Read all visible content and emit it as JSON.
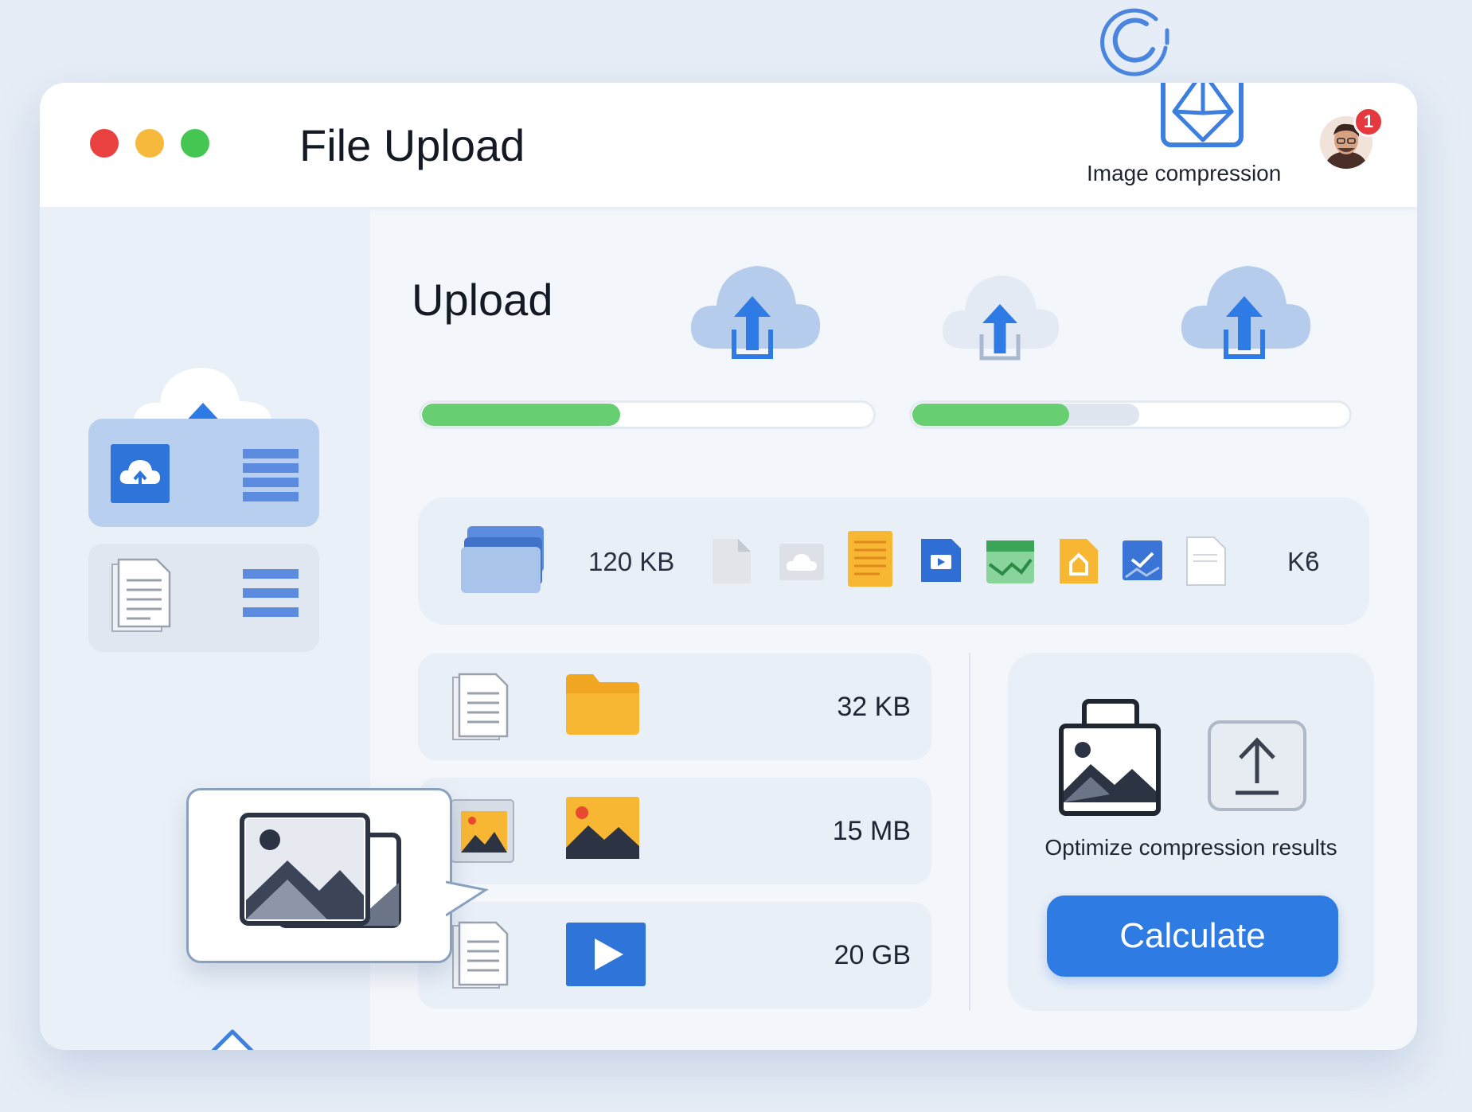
{
  "window": {
    "title": "File Upload",
    "controls": {
      "close_color": "#e8413f",
      "minimize_color": "#f6b93b",
      "maximize_color": "#45c653"
    }
  },
  "header": {
    "brand_label": "Image compression",
    "notifications": {
      "count": "1"
    }
  },
  "sidebar": {
    "items": [
      {
        "icon": "cloud-upload-icon",
        "secondary_icon": "list-icon",
        "active": true
      },
      {
        "icon": "document-icon",
        "secondary_icon": "list-icon",
        "active": false
      }
    ]
  },
  "main": {
    "title": "Upload",
    "progress": [
      {
        "value": 0.44
      },
      {
        "value": 0.36,
        "buffer": 0.52
      }
    ],
    "file_strip": {
      "size_label": "120 KB",
      "unit_label": "Kϐ",
      "icons": [
        "file-gray-icon",
        "cloud-icon",
        "orange-doc-icon",
        "video-icon",
        "image-green-icon",
        "orange-file-icon",
        "image-check-icon",
        "blank-doc-icon"
      ]
    },
    "files": [
      {
        "type": "folder",
        "size": "32 KB"
      },
      {
        "type": "image",
        "size": "15 MB"
      },
      {
        "type": "video",
        "size": "20 GB"
      }
    ]
  },
  "compression_panel": {
    "label": "Optimize compression results",
    "button_label": "Calculate"
  },
  "colors": {
    "accent": "#2e7be4",
    "progress": "#67cf72",
    "folder": "#f8b733",
    "badge": "#e6393f"
  }
}
